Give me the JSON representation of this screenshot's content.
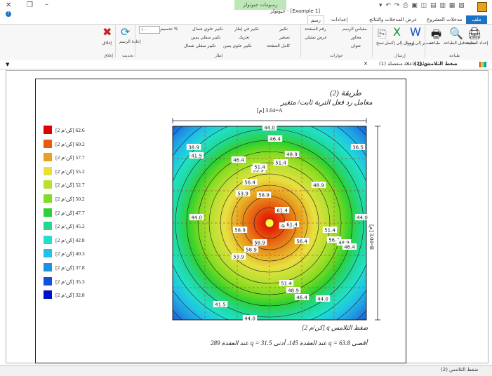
{
  "titlebar": {
    "context_tab": "رسومات جيوتولز",
    "window_title": "جيوتولز - [Example 1]"
  },
  "tabs": [
    {
      "label": "ملف"
    },
    {
      "label": "مدخلات المشروع"
    },
    {
      "label": "عرض المدخلات والنتائج"
    },
    {
      "label": "إعدادات"
    },
    {
      "label": "رسم"
    }
  ],
  "ribbon": {
    "groups": {
      "print": "طباعة",
      "send": "إرسال",
      "views": "حوارات",
      "frame": "إطار",
      "update": "تحديث",
      "close": "إغلاق"
    },
    "buttons": {
      "print": "إعداد الصفحة",
      "preview": "معاينة قبل الطباعة",
      "dxf": "طباعة",
      "word": "تصدير إلى وورد",
      "excel": "إرسال إلى إكسل",
      "copy": "نسخ",
      "scale": "مقياس الرسم",
      "axes": "محاور",
      "title": "عنوان",
      "page_num": "رقم الصفحة",
      "fit_show": "عرض تمثيلي",
      "zoom_in": "تكبير",
      "zoom_out": "تصغير",
      "full_page": "كامل الصفحة",
      "zoom_frame": "تكبير في إطار",
      "pan": "تحريك",
      "enlarge_top": "تكبير علوي يمين",
      "enlarge_nw": "تكبير علوي شمال",
      "enlarge_bottom": "تكبير سفلي يمين",
      "enlarge_bl": "تكبير سفلي شمال",
      "custom_pct": "تخصيص %",
      "zoom_value": "١٠٠",
      "redraw": "إعادة الرسم",
      "close": "إغلاق"
    }
  },
  "doc_tabs": {
    "active": "ضغط التلامس (2)",
    "other": "تحليل قاعدة منفصلة (1)"
  },
  "drawing": {
    "method": "طريقة (2)",
    "subtitle": "معامل رد فعل التربة ثابت/ متغير",
    "dim_top": "[م] 3.04=A",
    "dim_right": "[م] 3.04=B",
    "footer1": "ضغط التلامس q [كن/م 2]",
    "footer2": "أقصى q = 63.8 عند العقدة 145، أدنى q = 31.5 عند العقدة 289",
    "contour_labels": [
      "44.0",
      "46.4",
      "48.9",
      "51.4",
      "53.9",
      "56.4",
      "58.9",
      "61.4",
      "44.8",
      "41.5",
      "38.9",
      "36.5",
      "44.0",
      "46.4",
      "51.4",
      "53.9",
      "48.9",
      "58.9",
      "56.4",
      "51.4",
      "48.9",
      "46.4",
      "44.0",
      "41.5",
      "44.0",
      "53.9",
      "58.9",
      "56.4",
      "61.4",
      "58.9",
      "51.4",
      "48.9",
      "46.4",
      "44.0"
    ]
  },
  "legend": [
    {
      "value": "62.6",
      "unit": "[كن/م 2]",
      "color": "#e00000"
    },
    {
      "value": "60.2",
      "unit": "[كن/م 2]",
      "color": "#e85a10"
    },
    {
      "value": "57.7",
      "unit": "[كن/م 2]",
      "color": "#e8a020"
    },
    {
      "value": "55.2",
      "unit": "[كن/م 2]",
      "color": "#e8e040"
    },
    {
      "value": "52.7",
      "unit": "[كن/م 2]",
      "color": "#b8e030"
    },
    {
      "value": "50.2",
      "unit": "[كن/م 2]",
      "color": "#80dc20"
    },
    {
      "value": "47.7",
      "unit": "[كن/م 2]",
      "color": "#30d030"
    },
    {
      "value": "45.2",
      "unit": "[كن/م 2]",
      "color": "#20d890"
    },
    {
      "value": "42.8",
      "unit": "[كن/م 2]",
      "color": "#20e0c8"
    },
    {
      "value": "40.3",
      "unit": "[كن/م 2]",
      "color": "#20c0e8"
    },
    {
      "value": "37.8",
      "unit": "[كن/م 2]",
      "color": "#2090e0"
    },
    {
      "value": "35.3",
      "unit": "[كن/م 2]",
      "color": "#1050e0"
    },
    {
      "value": "32.8",
      "unit": "[كن/م 2]",
      "color": "#0010c8"
    }
  ],
  "status": {
    "text": "ضغط التلامس (2)"
  }
}
